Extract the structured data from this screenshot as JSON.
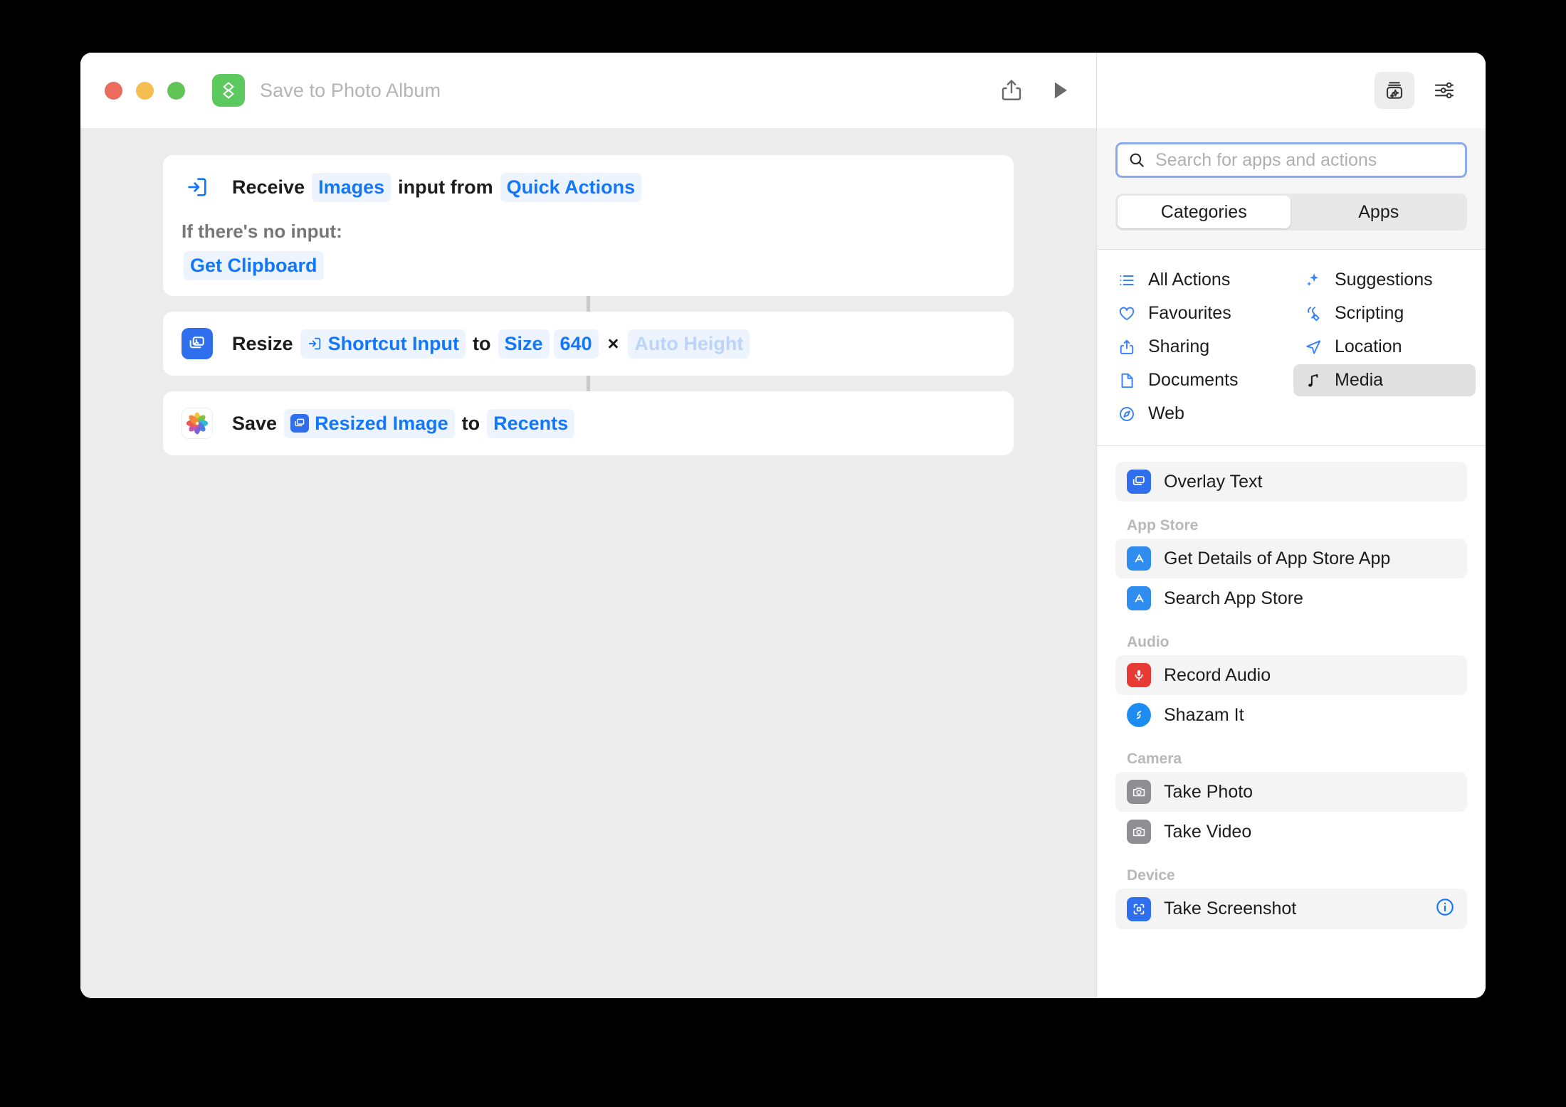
{
  "window": {
    "title": "Save to Photo Album",
    "app_icon": "shortcuts-icon",
    "traffic_lights": {
      "close": "#ec6a5e",
      "minimize": "#f5bd4f",
      "zoom": "#61c454"
    }
  },
  "toolbar": {
    "share": "share-icon",
    "run": "play-icon",
    "library": "action-library-icon",
    "details": "sliders-icon"
  },
  "flow": {
    "cards": [
      {
        "icon": "receive-input-icon",
        "parts": [
          {
            "type": "word",
            "text": "Receive"
          },
          {
            "type": "token",
            "text": "Images"
          },
          {
            "type": "word",
            "text": "input from"
          },
          {
            "type": "token",
            "text": "Quick Actions"
          }
        ],
        "subtitle": "If there's no input:",
        "fallback": "Get Clipboard"
      },
      {
        "icon": "resize-image-icon",
        "parts": [
          {
            "type": "word",
            "text": "Resize"
          },
          {
            "type": "token",
            "text": "Shortcut Input",
            "glyph": "input-arrow-icon"
          },
          {
            "type": "word",
            "text": "to"
          },
          {
            "type": "token",
            "text": "Size"
          },
          {
            "type": "token",
            "text": "640"
          },
          {
            "type": "times",
            "text": "×"
          },
          {
            "type": "placeholder",
            "text": "Auto Height"
          }
        ]
      },
      {
        "icon": "photos-app-icon",
        "parts": [
          {
            "type": "word",
            "text": "Save"
          },
          {
            "type": "token",
            "text": "Resized Image",
            "glyph": "resize-image-icon"
          },
          {
            "type": "word",
            "text": "to"
          },
          {
            "type": "token",
            "text": "Recents"
          }
        ]
      }
    ]
  },
  "sidebar": {
    "search": {
      "placeholder": "Search for apps and actions",
      "value": "",
      "icon": "search-icon"
    },
    "tabs": [
      {
        "label": "Categories",
        "selected": true
      },
      {
        "label": "Apps",
        "selected": false
      }
    ],
    "categories": [
      {
        "label": "All Actions",
        "icon": "list-icon",
        "selected": false
      },
      {
        "label": "Suggestions",
        "icon": "sparkles-icon",
        "selected": false
      },
      {
        "label": "Favourites",
        "icon": "heart-icon",
        "selected": false
      },
      {
        "label": "Scripting",
        "icon": "script-icon",
        "selected": false
      },
      {
        "label": "Sharing",
        "icon": "share-icon",
        "selected": false
      },
      {
        "label": "Location",
        "icon": "location-icon",
        "selected": false
      },
      {
        "label": "Documents",
        "icon": "document-icon",
        "selected": false
      },
      {
        "label": "Media",
        "icon": "music-note-icon",
        "selected": true
      },
      {
        "label": "Web",
        "icon": "compass-icon",
        "selected": false
      }
    ],
    "action_list": [
      {
        "kind": "action",
        "label": "Overlay Text",
        "icon": "overlay-text-icon",
        "alt": true
      },
      {
        "kind": "group",
        "label": "App Store"
      },
      {
        "kind": "action",
        "label": "Get Details of App Store App",
        "icon": "app-store-icon",
        "alt": true,
        "info": false
      },
      {
        "kind": "action",
        "label": "Search App Store",
        "icon": "app-store-icon",
        "alt": false,
        "info": false
      },
      {
        "kind": "group",
        "label": "Audio"
      },
      {
        "kind": "action",
        "label": "Record Audio",
        "icon": "microphone-icon",
        "alt": true,
        "info": false
      },
      {
        "kind": "action",
        "label": "Shazam It",
        "icon": "shazam-icon",
        "alt": false,
        "info": false
      },
      {
        "kind": "group",
        "label": "Camera"
      },
      {
        "kind": "action",
        "label": "Take Photo",
        "icon": "camera-icon",
        "alt": true,
        "info": false
      },
      {
        "kind": "action",
        "label": "Take Video",
        "icon": "camera-icon",
        "alt": false,
        "info": false
      },
      {
        "kind": "group",
        "label": "Device"
      },
      {
        "kind": "action",
        "label": "Take Screenshot",
        "icon": "screenshot-icon",
        "alt": true,
        "info": true
      }
    ]
  }
}
